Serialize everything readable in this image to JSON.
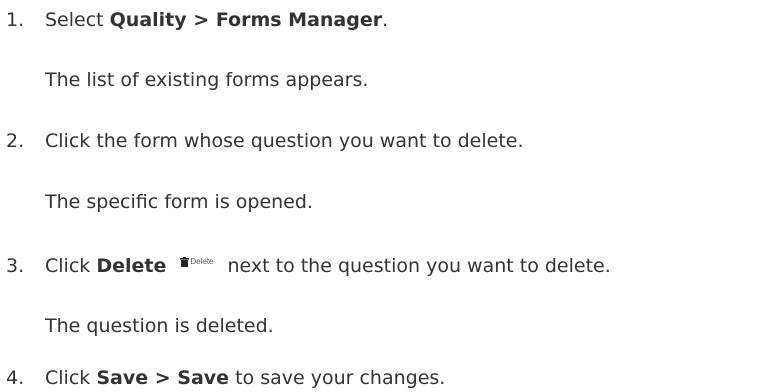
{
  "steps": [
    {
      "number": "1.",
      "pre": "Select ",
      "bold1": "Quality",
      "sep1": " > ",
      "bold2": "Forms Manager",
      "post": ".",
      "result": "The list of existing forms appears."
    },
    {
      "number": "2.",
      "text": "Click the form whose question you want to delete.",
      "result": "The specific form is opened."
    },
    {
      "number": "3.",
      "pre": "Click ",
      "bold1": "Delete",
      "icon_name": "trash-icon",
      "icon_label": "Delete",
      "post": "next to the question you want to delete.",
      "result": "The question is deleted."
    },
    {
      "number": "4.",
      "pre": "Click ",
      "bold1": "Save",
      "sep1": " > ",
      "bold2": "Save",
      "post": " to save your changes."
    }
  ]
}
